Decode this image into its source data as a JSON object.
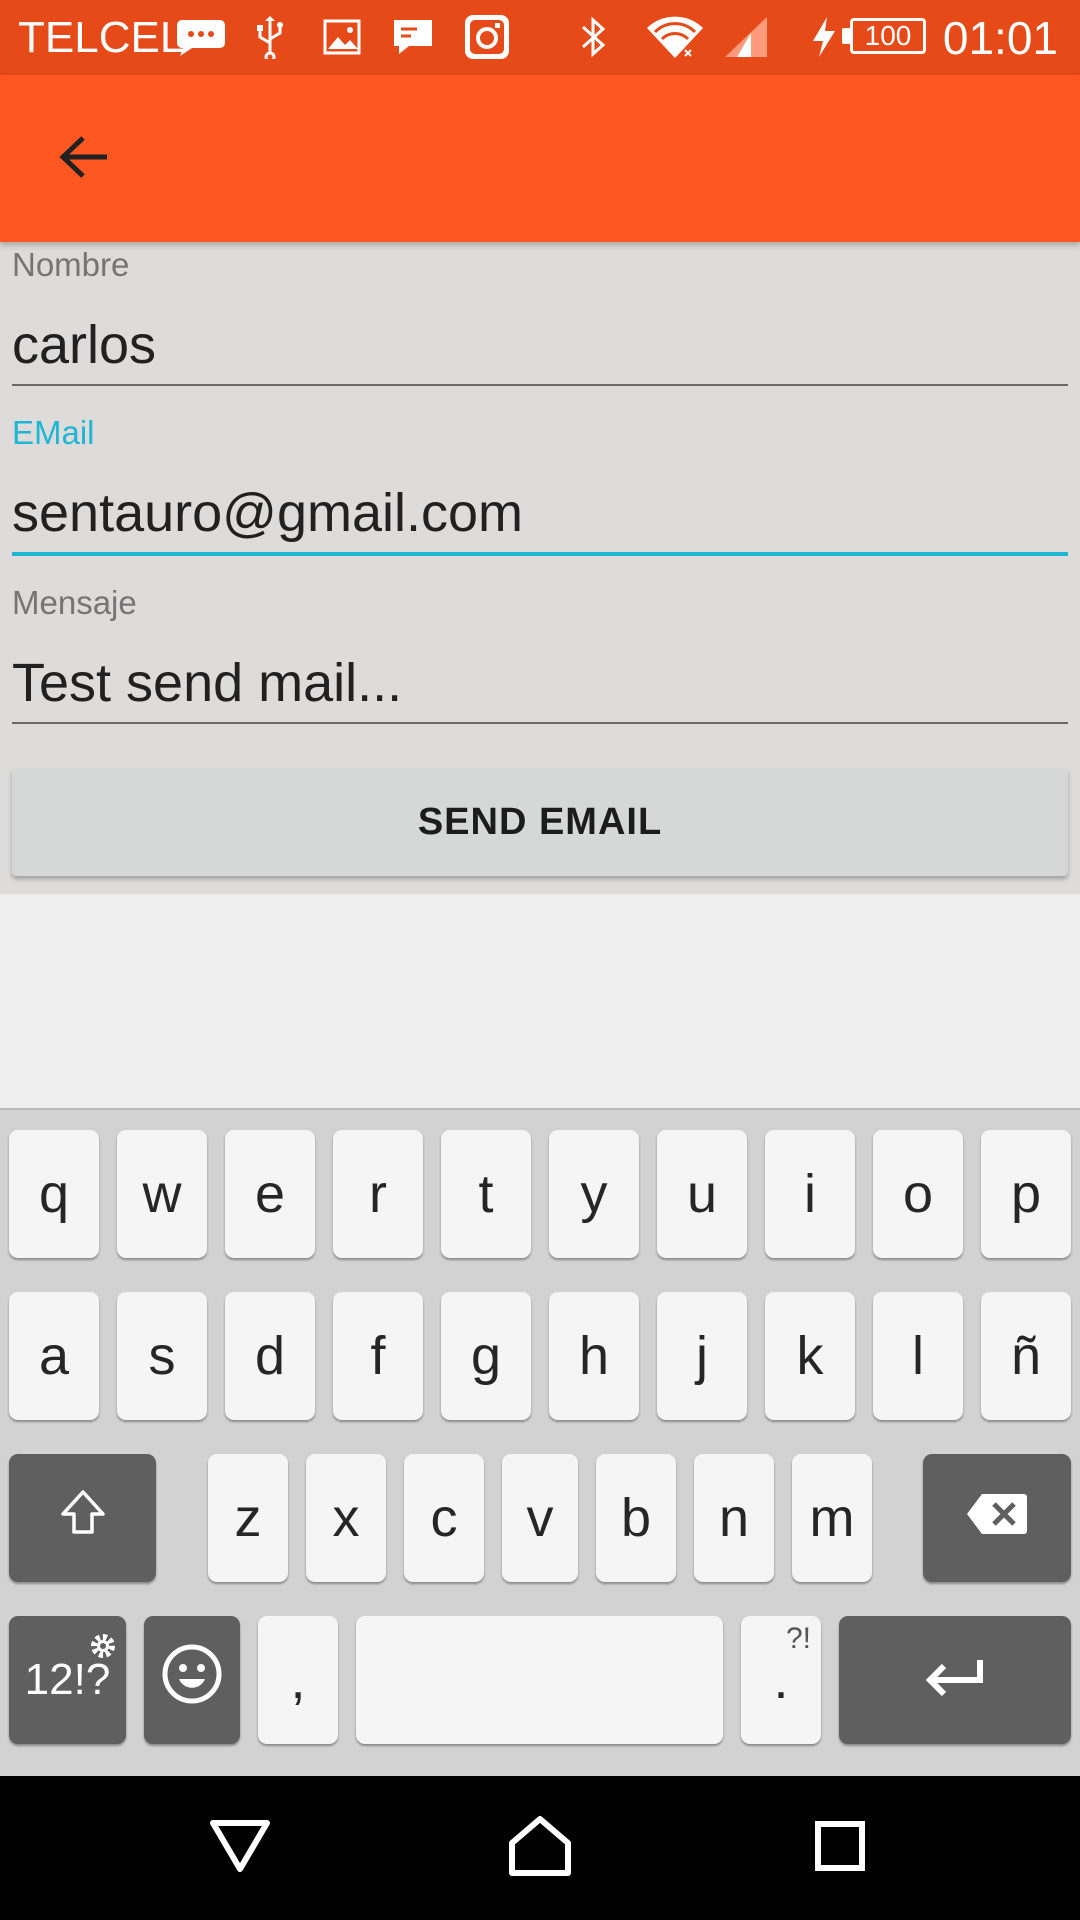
{
  "status_bar": {
    "carrier": "TELCEL",
    "battery": "100",
    "time": "01:01",
    "icons": [
      "message-icon",
      "usb-icon",
      "image-icon",
      "chat-icon",
      "instagram-icon",
      "bluetooth-icon",
      "wifi-icon",
      "signal-icon",
      "charging-icon",
      "battery-icon"
    ]
  },
  "toolbar": {
    "back_icon": "arrow-back-icon"
  },
  "form": {
    "name": {
      "label": "Nombre",
      "value": "carlos"
    },
    "email": {
      "label": "EMail",
      "value": "sentauro@gmail.com"
    },
    "message": {
      "label": "Mensaje",
      "value": "Test send mail..."
    },
    "send_button": "SEND EMAIL"
  },
  "keyboard": {
    "row1": [
      "q",
      "w",
      "e",
      "r",
      "t",
      "y",
      "u",
      "i",
      "o",
      "p"
    ],
    "row2": [
      "a",
      "s",
      "d",
      "f",
      "g",
      "h",
      "j",
      "k",
      "l",
      "ñ"
    ],
    "row3": [
      "z",
      "x",
      "c",
      "v",
      "b",
      "n",
      "m"
    ],
    "symbols_key": "12!?",
    "comma_key": ",",
    "period_key": ".",
    "period_hint": "?!"
  },
  "nav_bar": {
    "icons": [
      "back-triangle-icon",
      "home-icon",
      "recents-icon"
    ]
  },
  "colors": {
    "status_bar": "#e64a19",
    "toolbar": "#ff5722",
    "accent": "#1fb6d6"
  }
}
